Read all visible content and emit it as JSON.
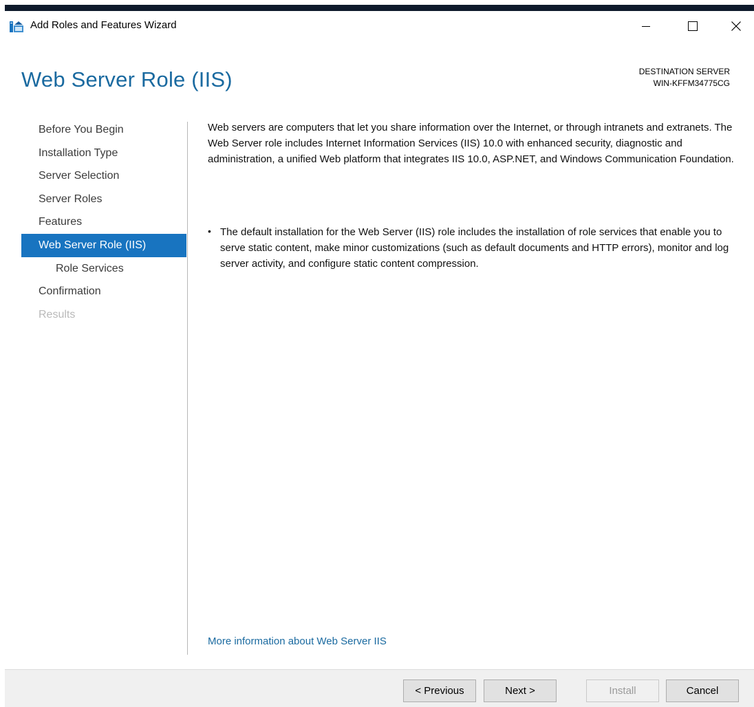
{
  "window": {
    "title": "Add Roles and Features Wizard",
    "icon": "server-manager-wizard-icon",
    "controls": [
      "minimize-icon",
      "maximize-icon",
      "close-icon"
    ]
  },
  "header": {
    "page_title": "Web Server Role (IIS)",
    "destination_label": "DESTINATION SERVER",
    "destination_server": "WIN-KFFM34775CG"
  },
  "nav": {
    "items": [
      {
        "label": "Before You Begin",
        "state": "normal"
      },
      {
        "label": "Installation Type",
        "state": "normal"
      },
      {
        "label": "Server Selection",
        "state": "normal"
      },
      {
        "label": "Server Roles",
        "state": "normal"
      },
      {
        "label": "Features",
        "state": "normal"
      },
      {
        "label": "Web Server Role (IIS)",
        "state": "active"
      },
      {
        "label": "Role Services",
        "state": "sub"
      },
      {
        "label": "Confirmation",
        "state": "normal"
      },
      {
        "label": "Results",
        "state": "disabled"
      }
    ]
  },
  "content": {
    "intro": "Web servers are computers that let you share information over the Internet, or through intranets and extranets. The Web Server role includes Internet Information Services (IIS) 10.0 with enhanced security, diagnostic and administration, a unified Web platform that integrates IIS 10.0, ASP.NET, and Windows Communication Foundation.",
    "bullet": "The default installation for the Web Server (IIS) role includes the installation of role services that enable you to serve static content, make minor customizations (such as default documents and HTTP errors), monitor and log server activity, and configure static content compression.",
    "more_link": "More information about Web Server IIS"
  },
  "footer": {
    "previous_label": "< Previous",
    "next_label": "Next >",
    "install_label": "Install",
    "cancel_label": "Cancel"
  },
  "colors": {
    "accent": "#1874c0",
    "title_blue": "#1a6aa0",
    "disabled_text": "#b9b9b9"
  }
}
